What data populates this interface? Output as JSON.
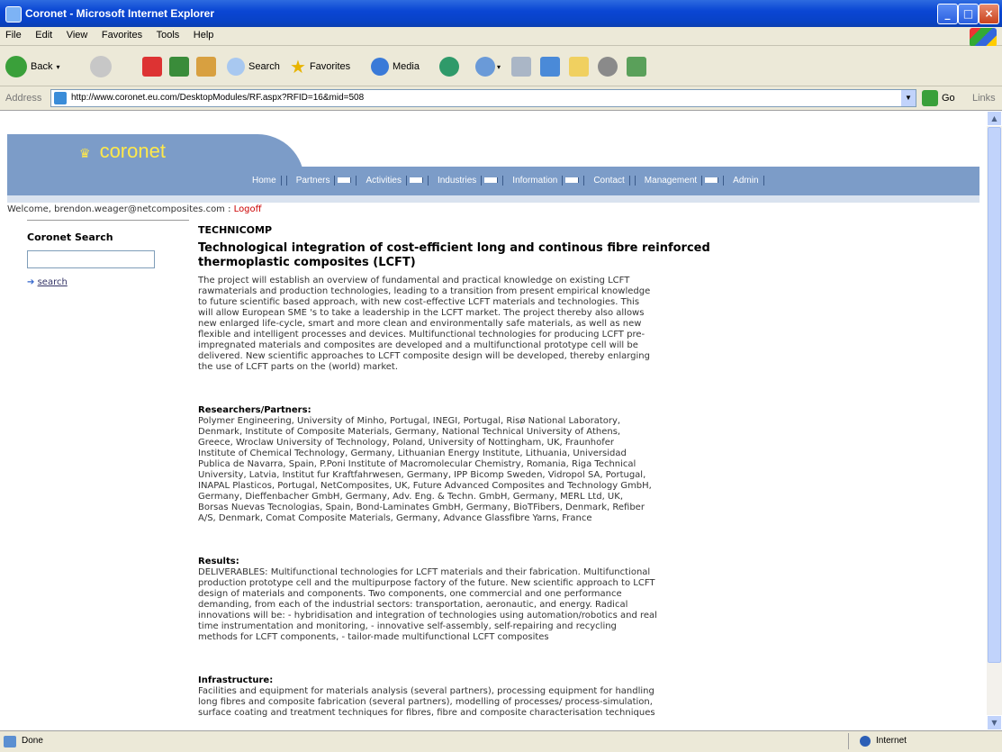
{
  "window": {
    "title": "Coronet - Microsoft Internet Explorer",
    "minimize": "_",
    "maximize": "□",
    "close": "×"
  },
  "menu": [
    "File",
    "Edit",
    "View",
    "Favorites",
    "Tools",
    "Help"
  ],
  "toolbar": {
    "back_label": "Back",
    "search_label": "Search",
    "favorites_label": "Favorites",
    "media_label": "Media"
  },
  "address": {
    "label": "Address",
    "url": "http://www.coronet.eu.com/DesktopModules/RF.aspx?RFID=16&mid=508",
    "go_label": "Go",
    "links_label": "Links"
  },
  "site": {
    "logo": "coronet",
    "nav": [
      {
        "label": "Home",
        "dropdown": false
      },
      {
        "label": "Partners",
        "dropdown": true
      },
      {
        "label": "Activities",
        "dropdown": true
      },
      {
        "label": "Industries",
        "dropdown": true
      },
      {
        "label": "Information",
        "dropdown": true
      },
      {
        "label": "Contact",
        "dropdown": false
      },
      {
        "label": "Management",
        "dropdown": true
      },
      {
        "label": "Admin",
        "dropdown": false
      }
    ],
    "welcome": "Welcome, brendon.weager@netcomposites.com",
    "logoff": "Logoff"
  },
  "sidebar": {
    "heading": "Coronet Search",
    "search_value": "",
    "search_link": "search"
  },
  "article": {
    "project": "TECHNICOMP",
    "title": "Technological integration of cost-efficient long and continous fibre reinforced thermoplastic composites (LCFT)",
    "intro": "The project will establish an overview of fundamental and practical knowledge on existing LCFT\nrawmaterials and production technologies, leading to a transition from present empirical knowledge\nto future scientific based approach, with new cost-effective LCFT materials and technologies. This\nwill allow European SME 's to take a leadership in the LCFT market. The project thereby also allows\nnew enlarged life-cycle, smart and more clean and environmentally safe materials, as well as new\nflexible and intelligent processes and devices. Multifunctional technologies for producing LCFT pre-\nimpregnated materials and composites are developed and a multifunctional prototype cell will be\ndelivered. New scientific approaches to LCFT composite design will be developed, thereby enlarging\nthe use of LCFT parts on the (world) market.",
    "partners_heading": "Researchers/Partners:",
    "partners": "Polymer Engineering, University of Minho, Portugal, INEGI, Portugal, Risø National Laboratory,\nDenmark, Institute of Composite Materials, Germany, National Technical University of Athens,\nGreece, Wroclaw University of Technology, Poland, University of Nottingham, UK, Fraunhofer\nInstitute of Chemical Technology, Germany, Lithuanian Energy Institute, Lithuania, Universidad\nPublica de Navarra, Spain, P.Poni Institute of Macromolecular Chemistry, Romania, Riga Technical\nUniversity, Latvia, Institut fur Kraftfahrwesen, Germany, IPP Bicomp Sweden, Vidropol SA, Portugal,\nINAPAL Plasticos, Portugal, NetComposites, UK, Future Advanced Composites and Technology GmbH,\nGermany, Dieffenbacher GmbH, Germany, Adv. Eng. & Techn. GmbH, Germany, MERL Ltd, UK,\nBorsas Nuevas Tecnologias, Spain, Bond-Laminates GmbH, Germany, BioTFibers, Denmark, Refiber\nA/S, Denmark, Comat Composite Materials, Germany, Advance Glassfibre Yarns, France",
    "results_heading": "Results:",
    "results": "DELIVERABLES: Multifunctional technologies for LCFT materials and their fabrication. Multifunctional\nproduction prototype cell and the multipurpose factory of the future. New scientific approach to LCFT\ndesign of materials and components. Two components, one commercial and one performance\ndemanding, from each of the industrial sectors: transportation, aeronautic, and energy. Radical\ninnovations will be: - hybridisation and integration of technologies using automation/robotics and real\ntime instrumentation and monitoring, - innovative self-assembly, self-repairing and recycling\nmethods for LCFT components, - tailor-made multifunctional LCFT composites",
    "infra_heading": "Infrastructure:",
    "infra": "Facilities and equipment for materials analysis (several partners), processing equipment for handling\nlong fibres and composite fabrication (several partners), modelling of processes/ process-simulation,\nsurface coating and treatment techniques for fibres, fibre and composite characterisation techniques"
  },
  "status": {
    "text": "Done",
    "zone": "Internet"
  }
}
